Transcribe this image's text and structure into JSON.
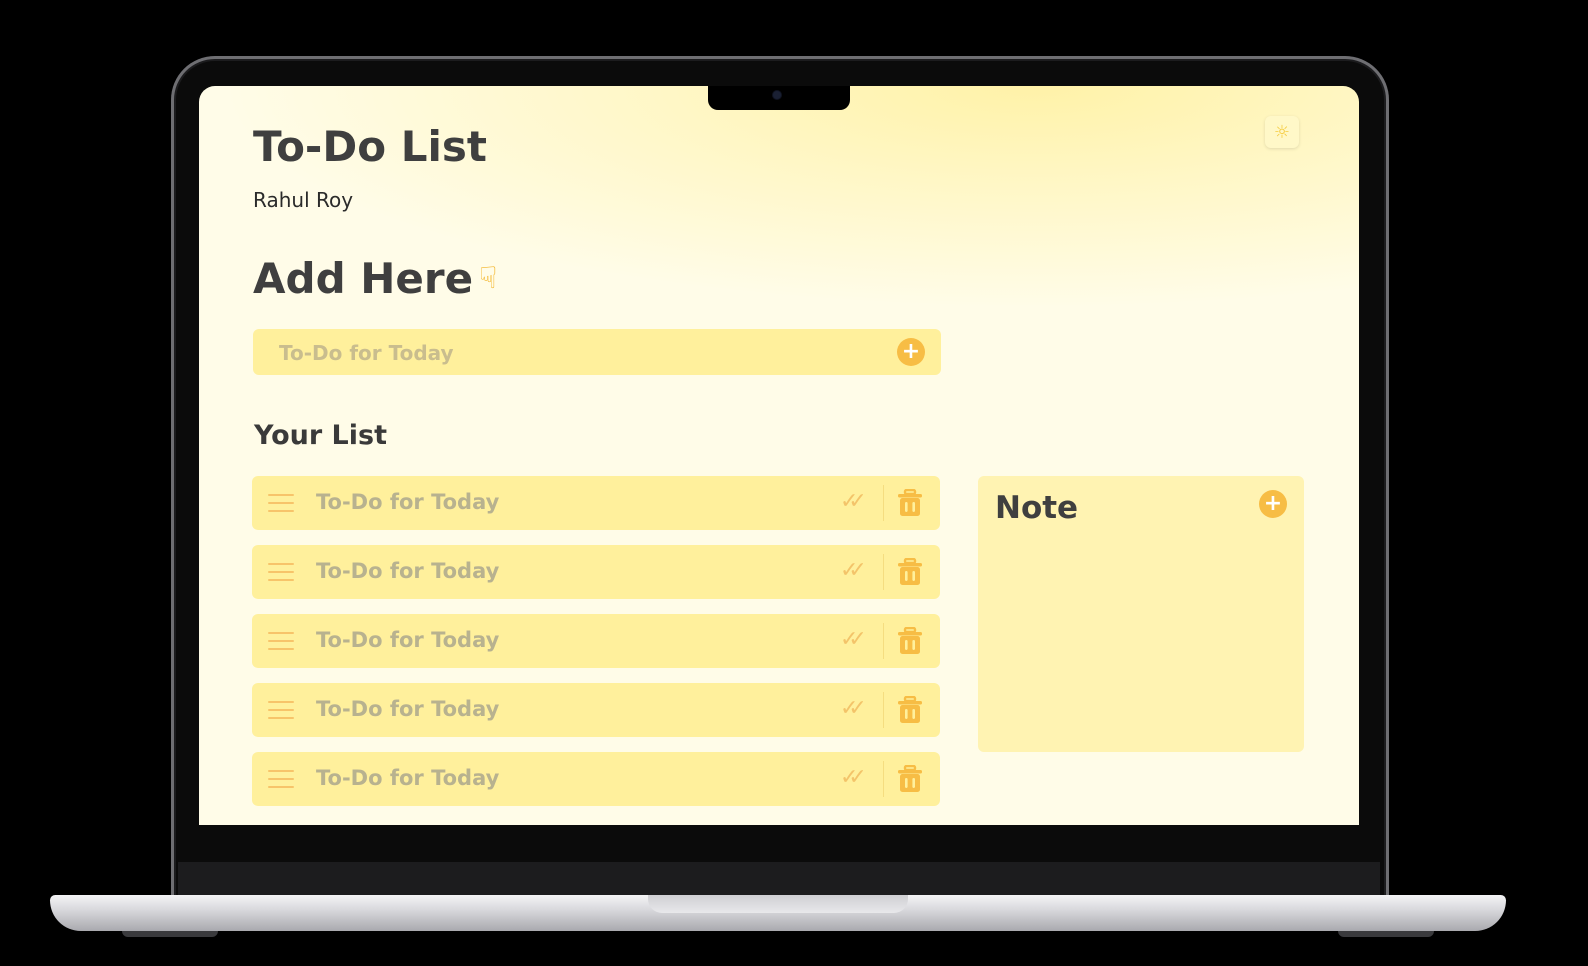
{
  "app": {
    "title": "To-Do List",
    "user_name": "Rahul Roy"
  },
  "theme_toggle": {
    "icon": "theme-toggle-icon"
  },
  "add_section": {
    "heading": "Add Here",
    "heading_icon": "pointing-down-hand-icon",
    "input_placeholder": "To-Do for Today",
    "add_button_icon": "plus-icon"
  },
  "list_section": {
    "heading": "Your List",
    "items": [
      {
        "text": "To-Do for Today"
      },
      {
        "text": "To-Do for Today"
      },
      {
        "text": "To-Do for Today"
      },
      {
        "text": "To-Do for Today"
      },
      {
        "text": "To-Do for Today"
      }
    ]
  },
  "note": {
    "title": "Note",
    "add_button_icon": "plus-icon"
  },
  "colors": {
    "accent": "#f7bd45",
    "item_background": "#fff09c",
    "note_background": "#fff3b2",
    "heading_text": "#3f3f3f"
  }
}
